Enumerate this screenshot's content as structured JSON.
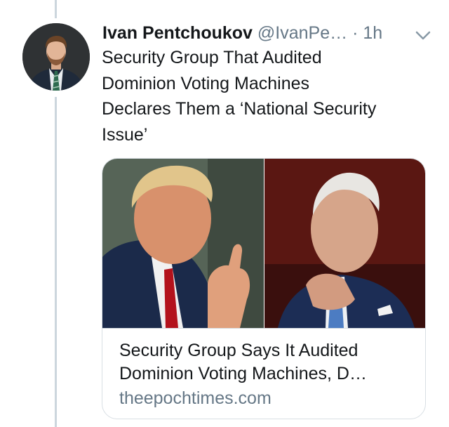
{
  "tweet": {
    "display_name": "Ivan Pentchoukov",
    "handle": "@IvanPe…",
    "separator": "·",
    "time": "1h",
    "text_lines": [
      "Security Group That Audited",
      "Dominion Voting Machines",
      "Declares Them a ‘National Security",
      "Issue’"
    ]
  },
  "card": {
    "title_lines": [
      "Security Group Says It Audited",
      "Dominion Voting Machines, D…"
    ],
    "domain": "theepochtimes.com"
  },
  "icons": {
    "menu": "chevron-down-icon"
  },
  "colors": {
    "text_primary": "#14171a",
    "text_secondary": "#657786",
    "border": "#d9dfe4",
    "thread_line": "#ccd6dd"
  }
}
